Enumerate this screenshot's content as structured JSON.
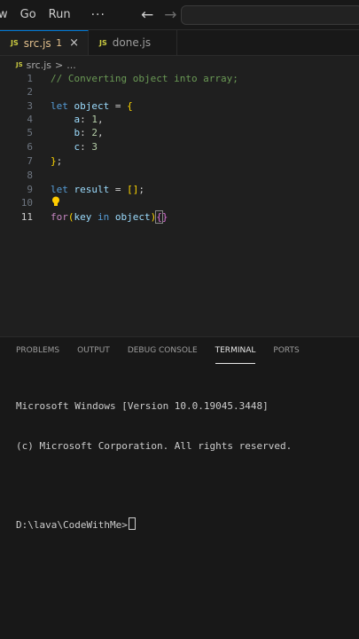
{
  "menubar": {
    "items": [
      "w",
      "Go",
      "Run"
    ],
    "more": "···",
    "back_icon": "arrow-left-icon",
    "forward_icon": "arrow-right-icon"
  },
  "tabs": [
    {
      "badge": "JS",
      "name": "src.js",
      "problems": "1",
      "close": "×",
      "active": true
    },
    {
      "badge": "JS",
      "name": "done.js",
      "active": false
    }
  ],
  "breadcrumb": {
    "badge": "JS",
    "file": "src.js",
    "separator": ">",
    "ellipsis": "..."
  },
  "editor": {
    "active_line": 11,
    "lines": [
      {
        "n": "1",
        "text": "// Converting object into array;"
      },
      {
        "n": "2",
        "text": ""
      },
      {
        "n": "3",
        "text": "let object = {"
      },
      {
        "n": "4",
        "text": "    a: 1,"
      },
      {
        "n": "5",
        "text": "    b: 2,"
      },
      {
        "n": "6",
        "text": "    c: 3"
      },
      {
        "n": "7",
        "text": "};"
      },
      {
        "n": "8",
        "text": ""
      },
      {
        "n": "9",
        "text": "let result = [];"
      },
      {
        "n": "10",
        "text": ""
      },
      {
        "n": "11",
        "text": "for(key in object){}"
      }
    ]
  },
  "panel": {
    "tabs": [
      "PROBLEMS",
      "OUTPUT",
      "DEBUG CONSOLE",
      "TERMINAL",
      "PORTS"
    ],
    "active_tab": "TERMINAL",
    "terminal": {
      "line1": "Microsoft Windows [Version 10.0.19045.3448]",
      "line2": "(c) Microsoft Corporation. All rights reserved.",
      "prompt": "D:\\lava\\CodeWithMe>"
    }
  },
  "colors": {
    "background": "#1f1f1f",
    "keyword": "#569cd6",
    "control": "#c586c0",
    "variable": "#9cdcfe",
    "number": "#b5cea8",
    "comment": "#6a9955",
    "modified_tab": "#e2c08d"
  }
}
